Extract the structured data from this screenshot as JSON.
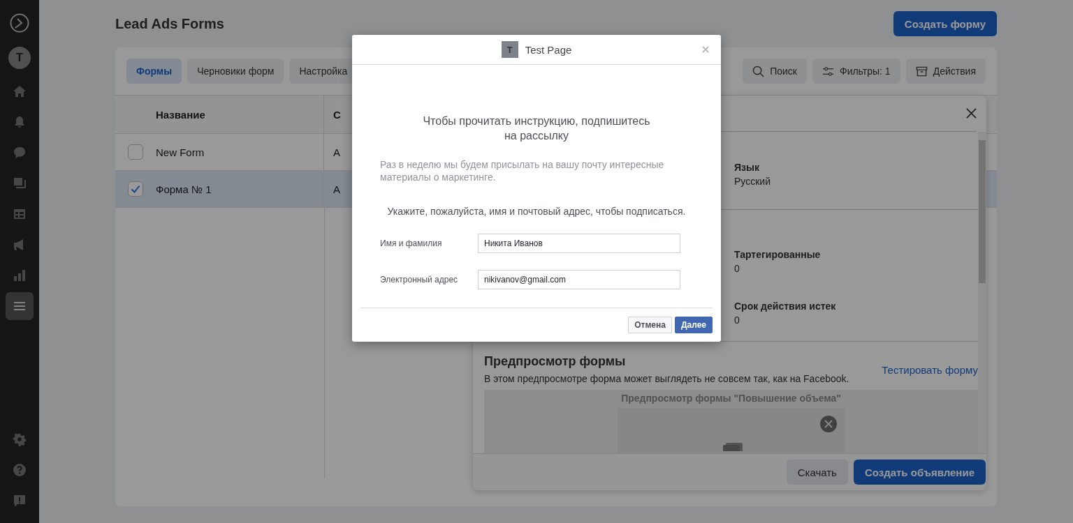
{
  "sidebar": {
    "avatar": "T",
    "items": [
      {
        "kind": "home",
        "selected": false
      },
      {
        "kind": "bell",
        "selected": false
      },
      {
        "kind": "chat",
        "selected": false
      },
      {
        "kind": "pages",
        "selected": false
      },
      {
        "kind": "table",
        "selected": false
      },
      {
        "kind": "megaphone",
        "selected": false
      },
      {
        "kind": "chart",
        "selected": false
      },
      {
        "kind": "menu",
        "selected": true
      }
    ],
    "bottom_items": [
      {
        "kind": "gear"
      },
      {
        "kind": "help"
      },
      {
        "kind": "feedback"
      }
    ]
  },
  "page": {
    "title": "Lead Ads Forms",
    "create_button": "Создать форму"
  },
  "tabs": [
    {
      "label": "Формы",
      "selected": true
    },
    {
      "label": "Черновики форм",
      "selected": false
    },
    {
      "label": "Настройка",
      "selected": false
    }
  ],
  "toolbar": [
    {
      "kind": "search",
      "label": "Поиск"
    },
    {
      "kind": "filter",
      "label": "Фильтры: 1"
    },
    {
      "kind": "actions",
      "label": "Действия"
    }
  ],
  "table": {
    "columns": [
      "Название",
      "С"
    ],
    "rows": [
      {
        "name": "New Form",
        "column_2": "А",
        "checked": false
      },
      {
        "name": "Форма № 1",
        "column_2": "А",
        "checked": true
      }
    ]
  },
  "details": {
    "fields": [
      {
        "label": "Язык",
        "value": "Русский"
      },
      {
        "label": "Тартегированные",
        "value": "0"
      },
      {
        "label": "Срок действия истек",
        "value": "0"
      }
    ],
    "preview": {
      "title": "Предпросмотр формы",
      "description": "В этом предпросмотре форма может выглядеть не совсем так, как на Facebook.",
      "link": "Тестировать форму",
      "box_title": "Предпросмотр формы \"Повышение объема\""
    },
    "buttons": [
      {
        "label": "Скачать",
        "kind": "secondary"
      },
      {
        "label": "Создать объявление",
        "kind": "primary"
      }
    ]
  },
  "dialog": {
    "avatar": "T",
    "page_name": "Test Page",
    "heading": "Чтобы прочитать инструкцию, подпишитесь на рассылку",
    "description": "Раз в неделю мы будем присылать на вашу почту интересные материалы о маркетинге.",
    "prompt": "Укажите, пожалуйста, имя и почтовый адрес, чтобы подписаться.",
    "fields": [
      {
        "label": "Имя и фамилия",
        "value": "Никита Иванов"
      },
      {
        "label": "Электронный адрес",
        "value": "nikivanov@gmail.com"
      }
    ],
    "buttons": [
      {
        "label": "Отмена",
        "kind": "secondary"
      },
      {
        "label": "Далее",
        "kind": "primary"
      }
    ]
  }
}
